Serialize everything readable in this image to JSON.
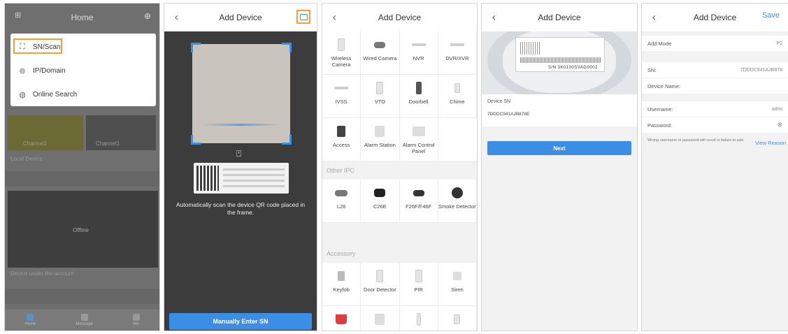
{
  "phone_home": {
    "title": "Home",
    "menu": [
      {
        "label": "SN/Scan",
        "icon": "scan-icon"
      },
      {
        "label": "IP/Domain",
        "icon": "ip-icon"
      },
      {
        "label": "Online Search",
        "icon": "globe-icon"
      }
    ],
    "device_section_1": "Local Device",
    "device_section_2": "Device under the account",
    "offline_label": "Offline",
    "channel_1": "Channel1",
    "channel_2": "Channel1",
    "tabs": [
      "Home",
      "Message",
      "Me"
    ]
  },
  "phone_scan": {
    "title": "Add Device",
    "tip": "Automatically scan the device QR code placed in the frame.",
    "manual_button": "Manually Enter SN"
  },
  "phone_type": {
    "title": "Add Device",
    "row1": [
      {
        "label": "Wireless Camera"
      },
      {
        "label": "Wired Camera"
      },
      {
        "label": "NVR"
      },
      {
        "label": "DVR/XVR"
      }
    ],
    "row2": [
      {
        "label": "IVSS"
      },
      {
        "label": "VTO"
      },
      {
        "label": "Doorbell"
      },
      {
        "label": "Chime"
      }
    ],
    "row3": [
      {
        "label": "Access"
      },
      {
        "label": "Alarm Station"
      },
      {
        "label": "Alarm Control Panel"
      }
    ],
    "other_ipc_title": "Other IPC",
    "other_ipc": [
      {
        "label": "L26"
      },
      {
        "label": "C26E"
      },
      {
        "label": "F26F/F46F"
      },
      {
        "label": "Smoke Detector"
      }
    ],
    "accessory_title": "Accessory",
    "accessory": [
      {
        "label": "Keyfob"
      },
      {
        "label": "Door Detector"
      },
      {
        "label": "PIR"
      },
      {
        "label": "Siren"
      }
    ]
  },
  "phone_sn": {
    "title": "Add Device",
    "sticker_sn": "S/N 3K0100SVAG0002",
    "device_sn_label": "Device SN",
    "device_sn_value": "7DDDC941AJB878E",
    "next_button": "Next"
  },
  "phone_login": {
    "title": "Add Device",
    "save": "Save",
    "add_mode_label": "Add Mode",
    "add_mode_value": "P2",
    "sn_label": "SN:",
    "sn_value": "7DDDC941AJB878",
    "device_name_label": "Device Name:",
    "username_label": "Username:",
    "username_value": "admi",
    "password_label": "Password:",
    "warning": "Wrong username or password will result in failure to add.",
    "view_reason": "View Reason"
  },
  "colors": {
    "accent": "#3a8ee6",
    "highlight": "#f0a030"
  }
}
